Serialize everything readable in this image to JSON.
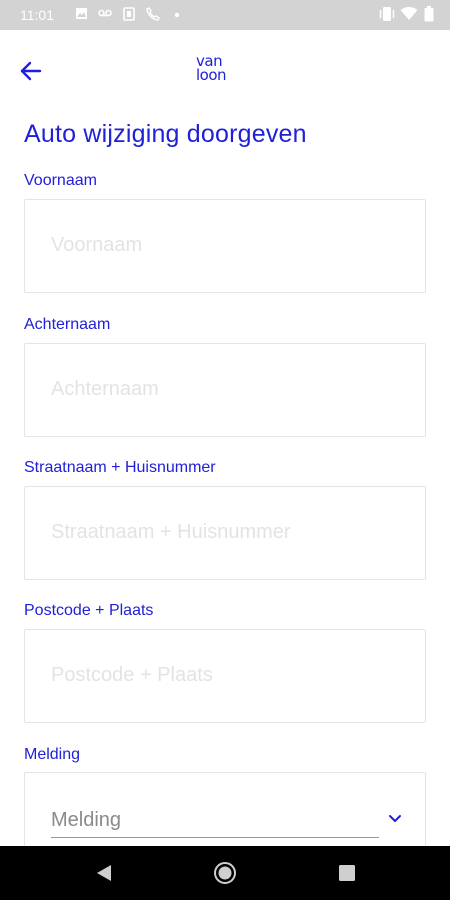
{
  "status_bar": {
    "time": "11:01",
    "left_icons": [
      "image-icon",
      "voicemail-icon",
      "sim-icon",
      "phone-call-icon",
      "dot-icon"
    ],
    "right_icons": [
      "vibrate-icon",
      "wifi-icon",
      "battery-icon"
    ]
  },
  "header": {
    "logo_line1": "van",
    "logo_line2": "loon"
  },
  "page": {
    "title": "Auto wijziging doorgeven"
  },
  "form": {
    "fields": [
      {
        "label": "Voornaam",
        "placeholder": "Voornaam",
        "value": ""
      },
      {
        "label": "Achternaam",
        "placeholder": "Achternaam",
        "value": ""
      },
      {
        "label": "Straatnaam + Huisnummer",
        "placeholder": "Straatnaam + Huisnummer",
        "value": ""
      },
      {
        "label": "Postcode + Plaats",
        "placeholder": "Postcode + Plaats",
        "value": ""
      }
    ],
    "melding": {
      "label": "Melding",
      "selected": "Melding"
    }
  },
  "colors": {
    "brand": "#2020d8",
    "status_bar": "#d3d3d3",
    "nav_bar": "#000000"
  }
}
